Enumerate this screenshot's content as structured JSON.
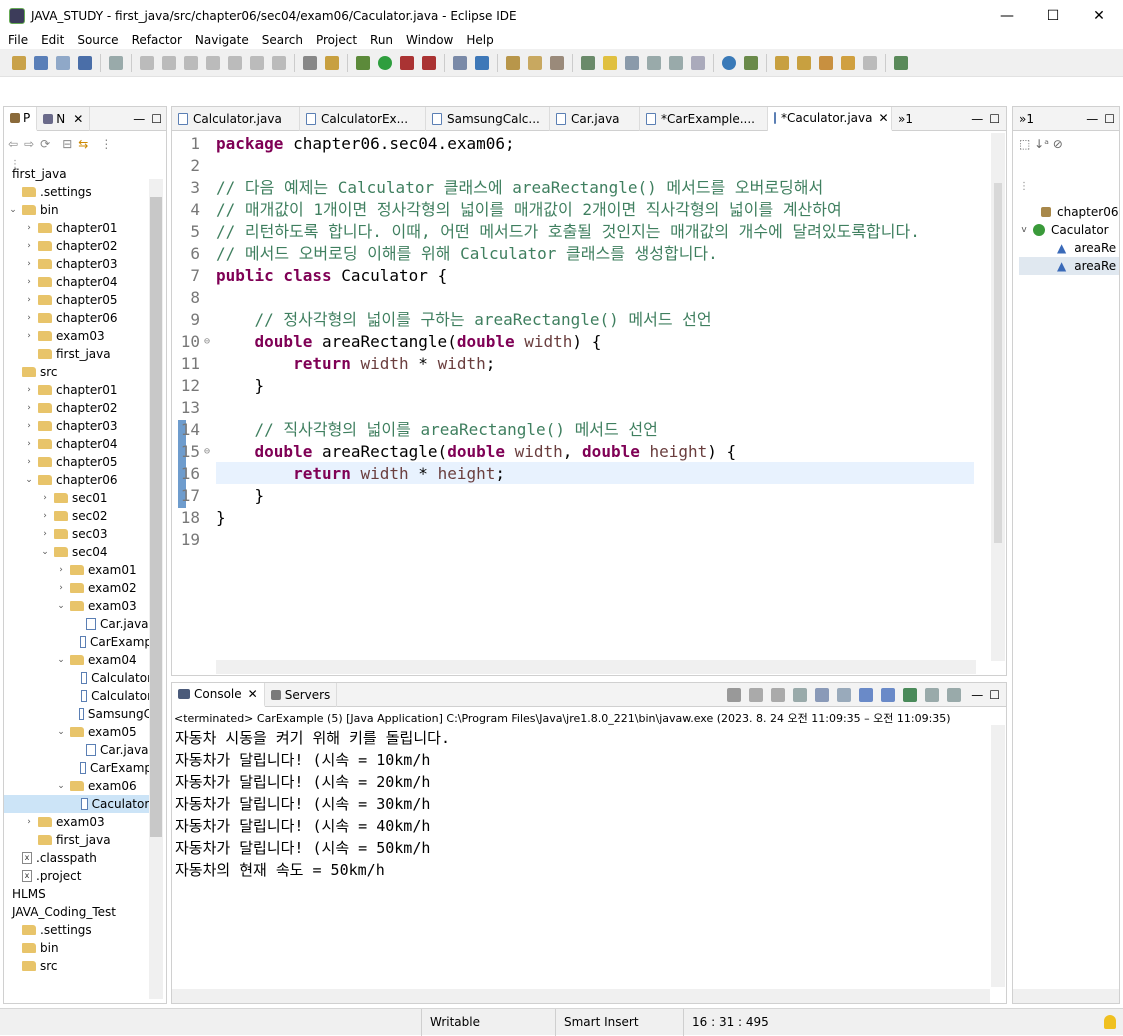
{
  "window": {
    "title": "JAVA_STUDY - first_java/src/chapter06/sec04/exam06/Caculator.java - Eclipse IDE",
    "minimize": "—",
    "maximize": "☐",
    "close": "✕"
  },
  "menu": [
    "File",
    "Edit",
    "Source",
    "Refactor",
    "Navigate",
    "Search",
    "Project",
    "Run",
    "Window",
    "Help"
  ],
  "left_panel": {
    "tabs": [
      "P",
      "N"
    ],
    "tree": [
      {
        "indent": 0,
        "type": "project",
        "chev": "",
        "label": "first_java",
        "open": true
      },
      {
        "indent": 0,
        "type": "folder",
        "chev": "",
        "label": ".settings"
      },
      {
        "indent": 0,
        "type": "folder",
        "chev": "v",
        "label": "bin"
      },
      {
        "indent": 1,
        "type": "folder",
        "chev": ">",
        "label": "chapter01"
      },
      {
        "indent": 1,
        "type": "folder",
        "chev": ">",
        "label": "chapter02"
      },
      {
        "indent": 1,
        "type": "folder",
        "chev": ">",
        "label": "chapter03"
      },
      {
        "indent": 1,
        "type": "folder",
        "chev": ">",
        "label": "chapter04"
      },
      {
        "indent": 1,
        "type": "folder",
        "chev": ">",
        "label": "chapter05"
      },
      {
        "indent": 1,
        "type": "folder",
        "chev": ">",
        "label": "chapter06"
      },
      {
        "indent": 1,
        "type": "folder",
        "chev": ">",
        "label": "exam03"
      },
      {
        "indent": 1,
        "type": "folder",
        "chev": "",
        "label": "first_java"
      },
      {
        "indent": 0,
        "type": "folder",
        "chev": "",
        "label": "src"
      },
      {
        "indent": 1,
        "type": "folder",
        "chev": ">",
        "label": "chapter01"
      },
      {
        "indent": 1,
        "type": "folder",
        "chev": ">",
        "label": "chapter02"
      },
      {
        "indent": 1,
        "type": "folder",
        "chev": ">",
        "label": "chapter03"
      },
      {
        "indent": 1,
        "type": "folder",
        "chev": ">",
        "label": "chapter04"
      },
      {
        "indent": 1,
        "type": "folder",
        "chev": ">",
        "label": "chapter05"
      },
      {
        "indent": 1,
        "type": "folder",
        "chev": "v",
        "label": "chapter06"
      },
      {
        "indent": 2,
        "type": "folder",
        "chev": ">",
        "label": "sec01"
      },
      {
        "indent": 2,
        "type": "folder",
        "chev": ">",
        "label": "sec02"
      },
      {
        "indent": 2,
        "type": "folder",
        "chev": ">",
        "label": "sec03"
      },
      {
        "indent": 2,
        "type": "folder",
        "chev": "v",
        "label": "sec04"
      },
      {
        "indent": 3,
        "type": "folder",
        "chev": ">",
        "label": "exam01"
      },
      {
        "indent": 3,
        "type": "folder",
        "chev": ">",
        "label": "exam02"
      },
      {
        "indent": 3,
        "type": "folder",
        "chev": "v",
        "label": "exam03"
      },
      {
        "indent": 4,
        "type": "file",
        "chev": "",
        "label": "Car.java"
      },
      {
        "indent": 4,
        "type": "file",
        "chev": "",
        "label": "CarExamp"
      },
      {
        "indent": 3,
        "type": "folder",
        "chev": "v",
        "label": "exam04"
      },
      {
        "indent": 4,
        "type": "file",
        "chev": "",
        "label": "Calculator"
      },
      {
        "indent": 4,
        "type": "file",
        "chev": "",
        "label": "Calculator"
      },
      {
        "indent": 4,
        "type": "file",
        "chev": "",
        "label": "SamsungC"
      },
      {
        "indent": 3,
        "type": "folder",
        "chev": "v",
        "label": "exam05"
      },
      {
        "indent": 4,
        "type": "file",
        "chev": "",
        "label": "Car.java"
      },
      {
        "indent": 4,
        "type": "file",
        "chev": "",
        "label": "CarExamp"
      },
      {
        "indent": 3,
        "type": "folder",
        "chev": "v",
        "label": "exam06"
      },
      {
        "indent": 4,
        "type": "file",
        "chev": "",
        "label": "Caculator.",
        "selected": true
      },
      {
        "indent": 1,
        "type": "folder",
        "chev": ">",
        "label": "exam03"
      },
      {
        "indent": 1,
        "type": "folder",
        "chev": "",
        "label": "first_java"
      },
      {
        "indent": 0,
        "type": "xfile",
        "chev": "",
        "label": ".classpath"
      },
      {
        "indent": 0,
        "type": "xfile",
        "chev": "",
        "label": ".project"
      },
      {
        "indent": 0,
        "type": "project",
        "chev": "",
        "label": "HLMS"
      },
      {
        "indent": 0,
        "type": "project",
        "chev": "",
        "label": "JAVA_Coding_Test"
      },
      {
        "indent": 0,
        "type": "folder",
        "chev": "",
        "label": ".settings"
      },
      {
        "indent": 0,
        "type": "folder",
        "chev": "",
        "label": "bin"
      },
      {
        "indent": 0,
        "type": "folder",
        "chev": "",
        "label": "src"
      }
    ]
  },
  "editor": {
    "tabs": [
      {
        "label": "Calculator.java",
        "active": false
      },
      {
        "label": "CalculatorEx...",
        "active": false
      },
      {
        "label": "SamsungCalc...",
        "active": false
      },
      {
        "label": "Car.java",
        "active": false
      },
      {
        "label": "*CarExample....",
        "active": false
      },
      {
        "label": "*Caculator.java",
        "active": true
      }
    ],
    "overflow": "»1",
    "lines": [
      [
        [
          "kw",
          "package"
        ],
        [
          "",
          "chapter06.sec04.exam06;"
        ]
      ],
      [],
      [
        [
          "cm",
          "// 다음 예제는 Calculator 클래스에 areaRectangle() 메서드를 오버로딩해서"
        ]
      ],
      [
        [
          "cm",
          "// 매개값이 1개이면 정사각형의 넓이를 매개값이 2개이면 직사각형의 넓이를 계산하여"
        ]
      ],
      [
        [
          "cm",
          "// 리턴하도록 합니다. 이때, 어떤 메서드가 호출될 것인지는 매개값의 개수에 달려있도록합니다."
        ]
      ],
      [
        [
          "cm",
          "// 메서드 오버로딩 이해를 위해 Calculator 클래스를 생성합니다."
        ]
      ],
      [
        [
          "kw",
          "public class"
        ],
        [
          "",
          "Caculator {"
        ]
      ],
      [],
      [
        [
          "",
          "    "
        ],
        [
          "cm",
          "// 정사각형의 넓이를 구하는 areaRectangle() 메서드 선언"
        ]
      ],
      [
        [
          "",
          "    "
        ],
        [
          "kw",
          "double"
        ],
        [
          "",
          " areaRectangle("
        ],
        [
          "kw",
          "double"
        ],
        [
          "",
          ""
        ],
        [
          "id",
          " width"
        ],
        [
          "",
          ") {"
        ]
      ],
      [
        [
          "",
          "        "
        ],
        [
          "kw",
          "return"
        ],
        [
          "id",
          " width"
        ],
        [
          "",
          " * "
        ],
        [
          "id",
          "width"
        ],
        [
          "",
          ";"
        ]
      ],
      [
        [
          "",
          "    }"
        ]
      ],
      [],
      [
        [
          "",
          "    "
        ],
        [
          "cm",
          "// 직사각형의 넓이를 areaRectangle() 메서드 선언"
        ]
      ],
      [
        [
          "",
          "    "
        ],
        [
          "kw",
          "double"
        ],
        [
          "",
          " areaRectagle("
        ],
        [
          "kw",
          "double"
        ],
        [
          "id",
          " width"
        ],
        [
          "",
          ", "
        ],
        [
          "kw",
          "double"
        ],
        [
          "id",
          " height"
        ],
        [
          "",
          ") {"
        ]
      ],
      [
        [
          "",
          "        "
        ],
        [
          "kw",
          "return"
        ],
        [
          "id",
          " width"
        ],
        [
          "",
          " * "
        ],
        [
          "id",
          "height"
        ],
        [
          "",
          ";"
        ]
      ],
      [
        [
          "",
          "    }"
        ]
      ],
      [
        [
          "",
          "}"
        ]
      ],
      []
    ]
  },
  "outline": {
    "tabs": [
      "»1"
    ],
    "items": [
      "chapter06",
      "Caculator",
      "areaRe",
      "areaRe"
    ]
  },
  "console": {
    "tabs": [
      "Console",
      "Servers"
    ],
    "header": "<terminated> CarExample (5) [Java Application] C:\\Program Files\\Java\\jre1.8.0_221\\bin\\javaw.exe  (2023. 8. 24 오전 11:09:35 – 오전 11:09:35)",
    "lines": [
      "자동차 시동을 켜기 위해 키를 돌립니다.",
      "자동차가 달립니다! (시속 = 10km/h",
      "자동차가 달립니다! (시속 = 20km/h",
      "자동차가 달립니다! (시속 = 30km/h",
      "자동차가 달립니다! (시속 = 40km/h",
      "자동차가 달립니다! (시속 = 50km/h",
      "자동차의 현재 속도 = 50km/h"
    ]
  },
  "status": {
    "writable": "Writable",
    "insert": "Smart Insert",
    "position": "16 : 31 : 495"
  }
}
